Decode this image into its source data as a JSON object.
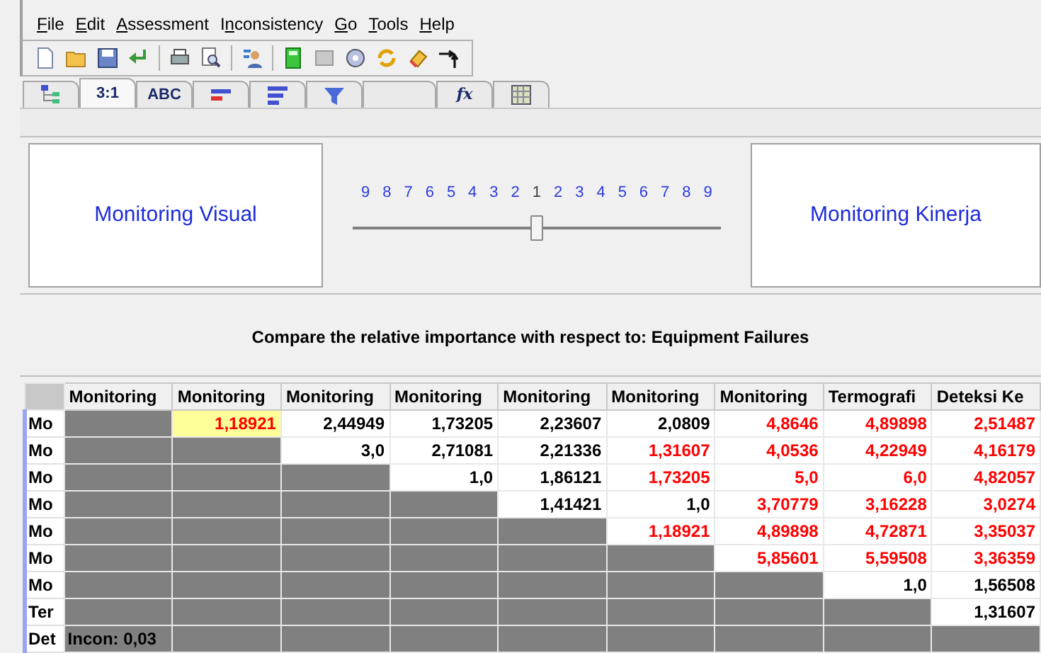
{
  "menu": [
    "File",
    "Edit",
    "Assessment",
    "Inconsistency",
    "Go",
    "Tools",
    "Help"
  ],
  "tabs": [
    {
      "kind": "tree",
      "selected": false
    },
    {
      "kind": "text",
      "label": "3:1",
      "selected": true
    },
    {
      "kind": "text",
      "label": "ABC",
      "selected": false
    },
    {
      "kind": "bars-red",
      "selected": false
    },
    {
      "kind": "bars",
      "selected": false
    },
    {
      "kind": "funnel",
      "selected": false
    },
    {
      "kind": "empty",
      "selected": false
    },
    {
      "kind": "text-italic",
      "label": "fx",
      "selected": false
    },
    {
      "kind": "grid",
      "selected": false
    }
  ],
  "left_node": "Monitoring Visual",
  "right_node": "Monitoring Kinerja",
  "scale": {
    "labels": [
      "9",
      "8",
      "7",
      "6",
      "5",
      "4",
      "3",
      "2",
      "1",
      "2",
      "3",
      "4",
      "5",
      "6",
      "7",
      "8",
      "9"
    ],
    "level": 0.5
  },
  "compare_text": "Compare the relative importance with respect to: Equipment Failures",
  "matrix": {
    "columns": [
      "Monitoring",
      "Monitoring",
      "Monitoring",
      "Monitoring",
      "Monitoring",
      "Monitoring",
      "Monitoring",
      "Termografi",
      "Deteksi Ke"
    ],
    "rows": [
      {
        "label": "Mo",
        "cells": [
          {
            "kind": "blank"
          },
          {
            "kind": "value",
            "value": "1,18921",
            "flagged": true,
            "selected": true
          },
          {
            "kind": "value",
            "value": "2,44949",
            "flagged": false,
            "selected": false
          },
          {
            "kind": "value",
            "value": "1,73205",
            "flagged": false,
            "selected": false
          },
          {
            "kind": "value",
            "value": "2,23607",
            "flagged": false,
            "selected": false
          },
          {
            "kind": "value",
            "value": "2,0809",
            "flagged": false,
            "selected": false
          },
          {
            "kind": "value",
            "value": "4,8646",
            "flagged": true,
            "selected": false
          },
          {
            "kind": "value",
            "value": "4,89898",
            "flagged": true,
            "selected": false
          },
          {
            "kind": "value",
            "value": "2,51487",
            "flagged": true,
            "selected": false
          }
        ]
      },
      {
        "label": "Mo",
        "cells": [
          {
            "kind": "blank"
          },
          {
            "kind": "blank"
          },
          {
            "kind": "value",
            "value": "3,0",
            "flagged": false,
            "selected": false
          },
          {
            "kind": "value",
            "value": "2,71081",
            "flagged": false,
            "selected": false
          },
          {
            "kind": "value",
            "value": "2,21336",
            "flagged": false,
            "selected": false
          },
          {
            "kind": "value",
            "value": "1,31607",
            "flagged": true,
            "selected": false
          },
          {
            "kind": "value",
            "value": "4,0536",
            "flagged": true,
            "selected": false
          },
          {
            "kind": "value",
            "value": "4,22949",
            "flagged": true,
            "selected": false
          },
          {
            "kind": "value",
            "value": "4,16179",
            "flagged": true,
            "selected": false
          }
        ]
      },
      {
        "label": "Mo",
        "cells": [
          {
            "kind": "blank"
          },
          {
            "kind": "blank"
          },
          {
            "kind": "blank"
          },
          {
            "kind": "value",
            "value": "1,0",
            "flagged": false,
            "selected": false
          },
          {
            "kind": "value",
            "value": "1,86121",
            "flagged": false,
            "selected": false
          },
          {
            "kind": "value",
            "value": "1,73205",
            "flagged": true,
            "selected": false
          },
          {
            "kind": "value",
            "value": "5,0",
            "flagged": true,
            "selected": false
          },
          {
            "kind": "value",
            "value": "6,0",
            "flagged": true,
            "selected": false
          },
          {
            "kind": "value",
            "value": "4,82057",
            "flagged": true,
            "selected": false
          }
        ]
      },
      {
        "label": "Mo",
        "cells": [
          {
            "kind": "blank"
          },
          {
            "kind": "blank"
          },
          {
            "kind": "blank"
          },
          {
            "kind": "blank"
          },
          {
            "kind": "value",
            "value": "1,41421",
            "flagged": false,
            "selected": false
          },
          {
            "kind": "value",
            "value": "1,0",
            "flagged": false,
            "selected": false
          },
          {
            "kind": "value",
            "value": "3,70779",
            "flagged": true,
            "selected": false
          },
          {
            "kind": "value",
            "value": "3,16228",
            "flagged": true,
            "selected": false
          },
          {
            "kind": "value",
            "value": "3,0274",
            "flagged": true,
            "selected": false
          }
        ]
      },
      {
        "label": "Mo",
        "cells": [
          {
            "kind": "blank"
          },
          {
            "kind": "blank"
          },
          {
            "kind": "blank"
          },
          {
            "kind": "blank"
          },
          {
            "kind": "blank"
          },
          {
            "kind": "value",
            "value": "1,18921",
            "flagged": true,
            "selected": false
          },
          {
            "kind": "value",
            "value": "4,89898",
            "flagged": true,
            "selected": false
          },
          {
            "kind": "value",
            "value": "4,72871",
            "flagged": true,
            "selected": false
          },
          {
            "kind": "value",
            "value": "3,35037",
            "flagged": true,
            "selected": false
          }
        ]
      },
      {
        "label": "Mo",
        "cells": [
          {
            "kind": "blank"
          },
          {
            "kind": "blank"
          },
          {
            "kind": "blank"
          },
          {
            "kind": "blank"
          },
          {
            "kind": "blank"
          },
          {
            "kind": "blank"
          },
          {
            "kind": "value",
            "value": "5,85601",
            "flagged": true,
            "selected": false
          },
          {
            "kind": "value",
            "value": "5,59508",
            "flagged": true,
            "selected": false
          },
          {
            "kind": "value",
            "value": "3,36359",
            "flagged": true,
            "selected": false
          }
        ]
      },
      {
        "label": "Mo",
        "cells": [
          {
            "kind": "blank"
          },
          {
            "kind": "blank"
          },
          {
            "kind": "blank"
          },
          {
            "kind": "blank"
          },
          {
            "kind": "blank"
          },
          {
            "kind": "blank"
          },
          {
            "kind": "blank"
          },
          {
            "kind": "value",
            "value": "1,0",
            "flagged": false,
            "selected": false
          },
          {
            "kind": "value",
            "value": "1,56508",
            "flagged": false,
            "selected": false
          }
        ]
      },
      {
        "label": "Ter",
        "cells": [
          {
            "kind": "blank"
          },
          {
            "kind": "blank"
          },
          {
            "kind": "blank"
          },
          {
            "kind": "blank"
          },
          {
            "kind": "blank"
          },
          {
            "kind": "blank"
          },
          {
            "kind": "blank"
          },
          {
            "kind": "blank"
          },
          {
            "kind": "value",
            "value": "1,31607",
            "flagged": false,
            "selected": false
          }
        ]
      },
      {
        "label": "Det",
        "cells": [
          {
            "kind": "note",
            "value": "Incon: 0,03"
          },
          {
            "kind": "blank"
          },
          {
            "kind": "blank"
          },
          {
            "kind": "blank"
          },
          {
            "kind": "blank"
          },
          {
            "kind": "blank"
          },
          {
            "kind": "blank"
          },
          {
            "kind": "blank"
          },
          {
            "kind": "blank"
          }
        ]
      }
    ]
  }
}
